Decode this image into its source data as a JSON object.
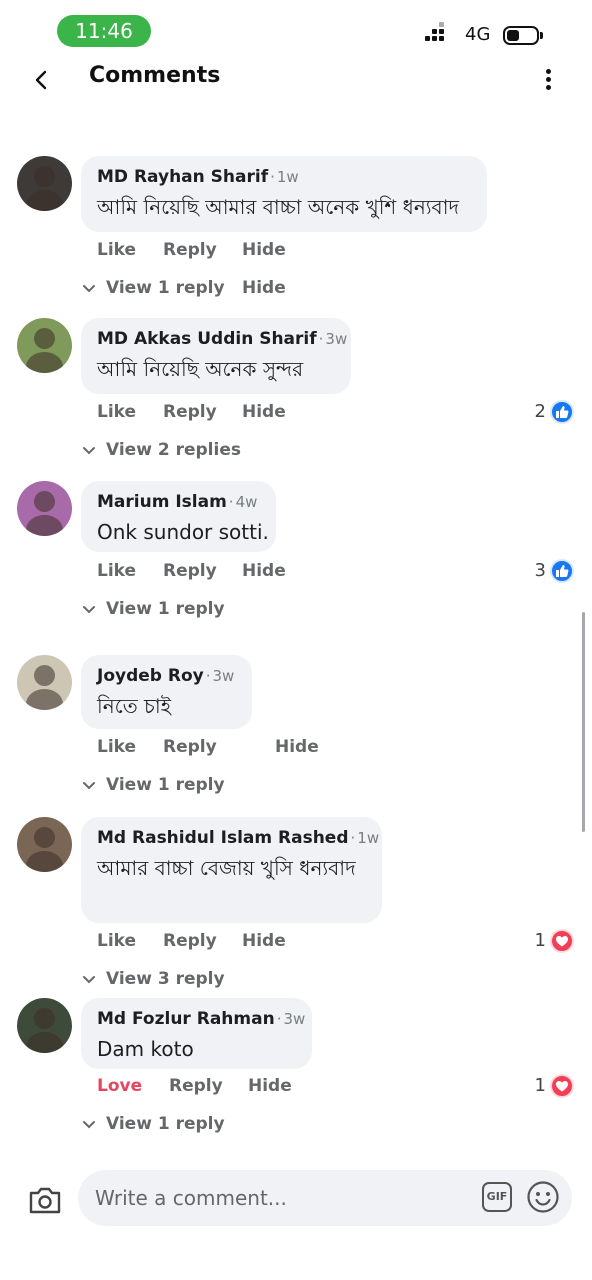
{
  "status_bar": {
    "time": "11:46",
    "network": "4G"
  },
  "header": {
    "title": "Comments"
  },
  "comments": [
    {
      "author": "MD Rayhan Sharif",
      "age": "1w",
      "text": "আমি নিয়েছি আমার বাচ্চা অনেক খুশি ধন্যবাদ",
      "actions": {
        "like": "Like",
        "reply": "Reply",
        "hide": "Hide"
      },
      "reaction_count": "",
      "reaction_icon": "",
      "view_replies": "View 1 reply",
      "view_replies_hide": "Hide",
      "avatar_color": "#3d3a37"
    },
    {
      "author": "MD Akkas Uddin Sharif",
      "age": "3w",
      "text": "আমি নিয়েছি অনেক সুন্দর",
      "actions": {
        "like": "Like",
        "reply": "Reply",
        "hide": "Hide"
      },
      "reaction_count": "2",
      "reaction_icon": "like-icon",
      "view_replies": "View 2 replies",
      "view_replies_hide": "",
      "avatar_color": "#7f9a5a"
    },
    {
      "author": "Marium Islam",
      "age": "4w",
      "text": "Onk sundor sotti.",
      "actions": {
        "like": "Like",
        "reply": "Reply",
        "hide": "Hide"
      },
      "reaction_count": "3",
      "reaction_icon": "like-icon",
      "view_replies": "View 1 reply",
      "view_replies_hide": "",
      "avatar_color": "#a86aa8"
    },
    {
      "author": "Joydeb Roy",
      "age": "3w",
      "text": "নিতে চাই",
      "actions": {
        "like": "Like",
        "reply": "Reply",
        "hide": "Hide"
      },
      "reaction_count": "",
      "reaction_icon": "",
      "view_replies": "View 1 reply",
      "view_replies_hide": "",
      "avatar_color": "#cdc6b4"
    },
    {
      "author": "Md Rashidul Islam Rashed",
      "age": "1w",
      "text": "আমার বাচ্চা বেজায় খুসি ধন্যবাদ",
      "actions": {
        "like": "Like",
        "reply": "Reply",
        "hide": "Hide"
      },
      "reaction_count": "1",
      "reaction_icon": "love-icon",
      "view_replies": "View 3 reply",
      "view_replies_hide": "",
      "avatar_color": "#7a6655"
    },
    {
      "author": "Md Fozlur Rahman",
      "age": "3w",
      "text": "Dam koto",
      "actions": {
        "like": "Love",
        "reply": "Reply",
        "hide": "Hide"
      },
      "reaction_count": "1",
      "reaction_icon": "love-icon",
      "view_replies": "View 1 reply",
      "view_replies_hide": "",
      "avatar_color": "#3e4a3a"
    }
  ],
  "composer": {
    "placeholder": "Write a comment...",
    "gif_label": "GIF"
  },
  "colors": {
    "like": "#1877f2",
    "love": "#f33e58",
    "time_pill": "#3bb54a",
    "bubble": "#f0f2f5"
  }
}
